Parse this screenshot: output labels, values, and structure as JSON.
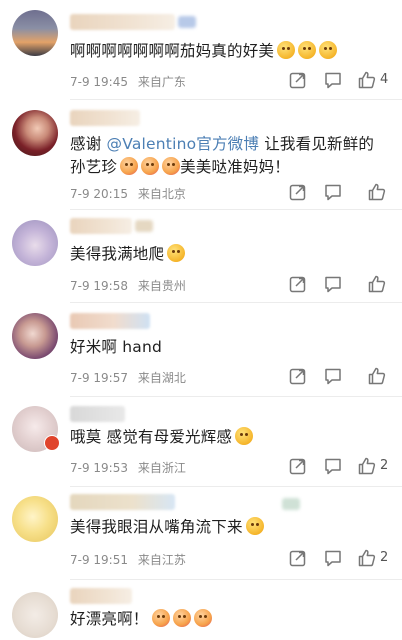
{
  "comments": [
    {
      "text_parts": [
        "啊啊啊啊啊啊啊茄妈真的好美"
      ],
      "emojis": 3,
      "time": "7-9 19:45",
      "source": "来自广东",
      "likes": "4"
    },
    {
      "text_before": "感谢 ",
      "mention": "@Valentino官方微博",
      "text_after": " 让我看见新鲜的孙艺珍",
      "text_end": "美美哒准妈妈！",
      "time": "7-9 20:15",
      "source": "来自北京",
      "likes": ""
    },
    {
      "text_parts": [
        "美得我满地爬"
      ],
      "time": "7-9 19:58",
      "source": "来自贵州",
      "likes": ""
    },
    {
      "text_parts": [
        "好米啊 hand"
      ],
      "time": "7-9 19:57",
      "source": "来自湖北",
      "likes": ""
    },
    {
      "text_parts": [
        "哦莫 感觉有母爱光辉感"
      ],
      "time": "7-9 19:53",
      "source": "来自浙江",
      "likes": "2"
    },
    {
      "text_parts": [
        "美得我眼泪从嘴角流下来"
      ],
      "time": "7-9 19:51",
      "source": "来自江苏",
      "likes": "2"
    },
    {
      "text_parts": [
        "好漂亮啊！"
      ],
      "time": "",
      "source": "",
      "likes": ""
    }
  ],
  "icons": {
    "share": "share-icon",
    "comment": "comment-icon",
    "like": "thumbs-up-icon"
  },
  "colors": {
    "mention": "#4c7fb4",
    "meta": "#8a8a8a"
  }
}
